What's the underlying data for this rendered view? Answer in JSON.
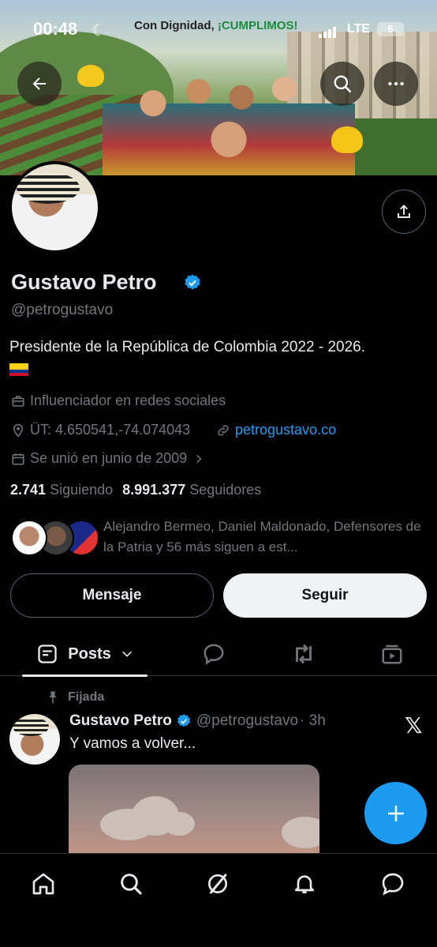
{
  "status_bar": {
    "time": "00:48",
    "carrier_text": "Con Dignidad,",
    "carrier_highlight": "¡CUMPLIMOS!",
    "network": "LTE",
    "battery": "6"
  },
  "banner": {
    "image": "banner-photo"
  },
  "profile": {
    "name": "Gustavo Petro",
    "handle": "@petrogustavo",
    "bio": "Presidente de la República de Colombia 2022 - 2026.",
    "profession": "Influenciador en redes sociales",
    "location": "ÜT: 4.650541,-74.074043",
    "website": "petrogustavo.co",
    "joined": "Se unió en junio de 2009",
    "following_count": "2.741",
    "following_label": "Siguiendo",
    "followers_count": "8.991.377",
    "followers_label": "Seguidores",
    "mutuals_text": "Alejandro Bermeo, Daniel Maldonado, Defensores de la Patria y 56 más siguen a est..."
  },
  "actions": {
    "message_label": "Mensaje",
    "follow_label": "Seguir"
  },
  "tabs": {
    "posts_label": "Posts"
  },
  "pinned_post": {
    "pinned_label": "Fijada",
    "author_name": "Gustavo Petro",
    "author_handle": "@petrogustavo",
    "time_ago": "· 3h",
    "text": "Y vamos a volver..."
  },
  "colors": {
    "accent": "#1d9bf0",
    "background": "#000000",
    "verified": "#1d9bf0"
  },
  "icons": [
    "back-arrow-icon",
    "search-icon",
    "more-icon",
    "share-icon",
    "verified-icon",
    "briefcase-icon",
    "location-icon",
    "link-icon",
    "calendar-icon",
    "chevron-right-icon",
    "chevron-down-icon",
    "posts-icon",
    "reply-icon",
    "repost-icon",
    "media-icon",
    "pin-icon",
    "x-logo-icon",
    "compose-icon",
    "home-icon",
    "explore-icon",
    "grok-icon",
    "notifications-icon",
    "messages-icon"
  ]
}
